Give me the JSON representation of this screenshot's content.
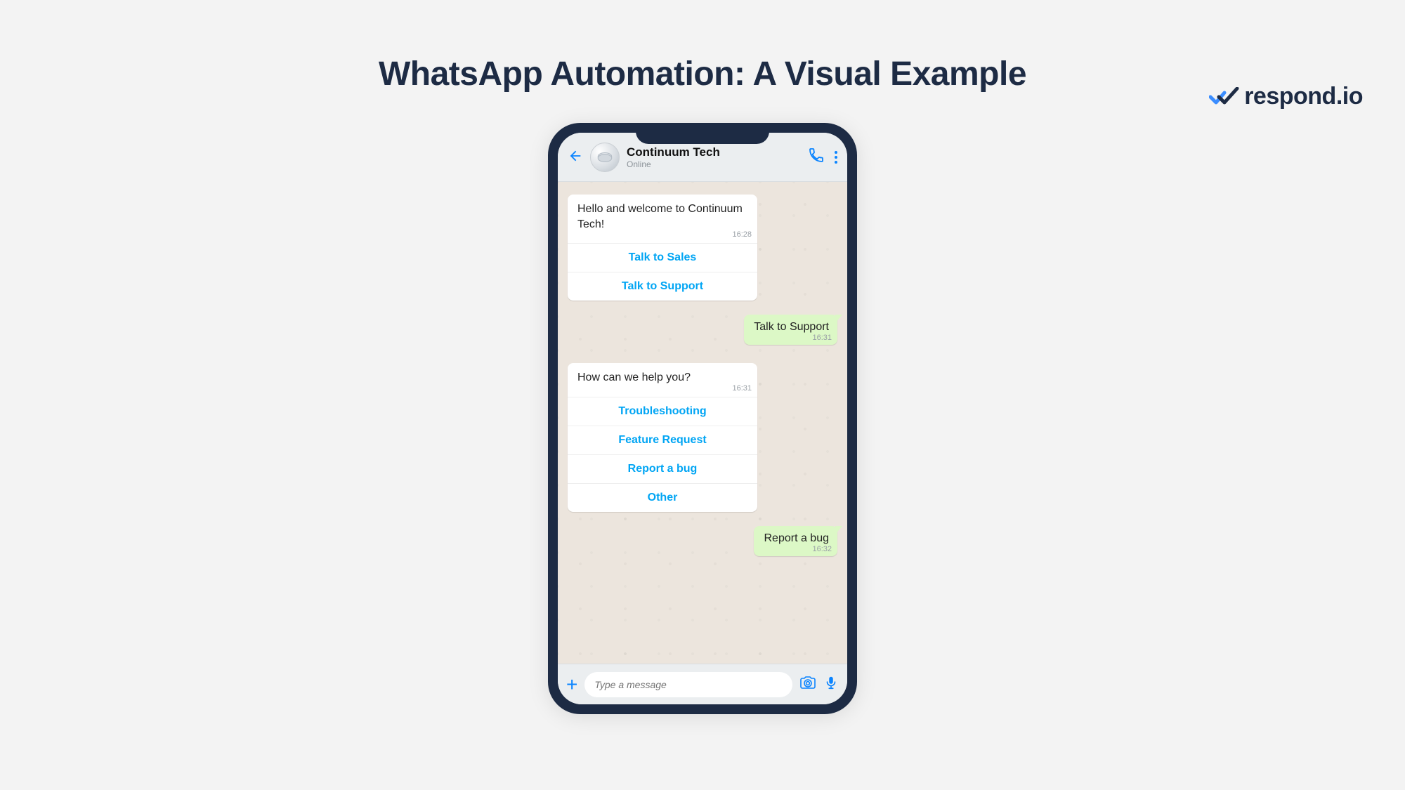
{
  "brand": {
    "name": "respond.io"
  },
  "page": {
    "title": "WhatsApp Automation: A Visual Example"
  },
  "chat": {
    "contact_name": "Continuum Tech",
    "contact_status": "Online",
    "messages": [
      {
        "type": "incoming",
        "text": "Hello and welcome to Continuum Tech!",
        "time": "16:28",
        "buttons": [
          "Talk to Sales",
          "Talk to Support"
        ]
      },
      {
        "type": "outgoing",
        "text": "Talk to Support",
        "time": "16:31"
      },
      {
        "type": "incoming",
        "text": "How can we help you?",
        "time": "16:31",
        "buttons": [
          "Troubleshooting",
          "Feature Request",
          "Report a bug",
          "Other"
        ]
      },
      {
        "type": "outgoing",
        "text": "Report a bug",
        "time": "16:32"
      }
    ],
    "composer": {
      "placeholder": "Type a message"
    }
  }
}
